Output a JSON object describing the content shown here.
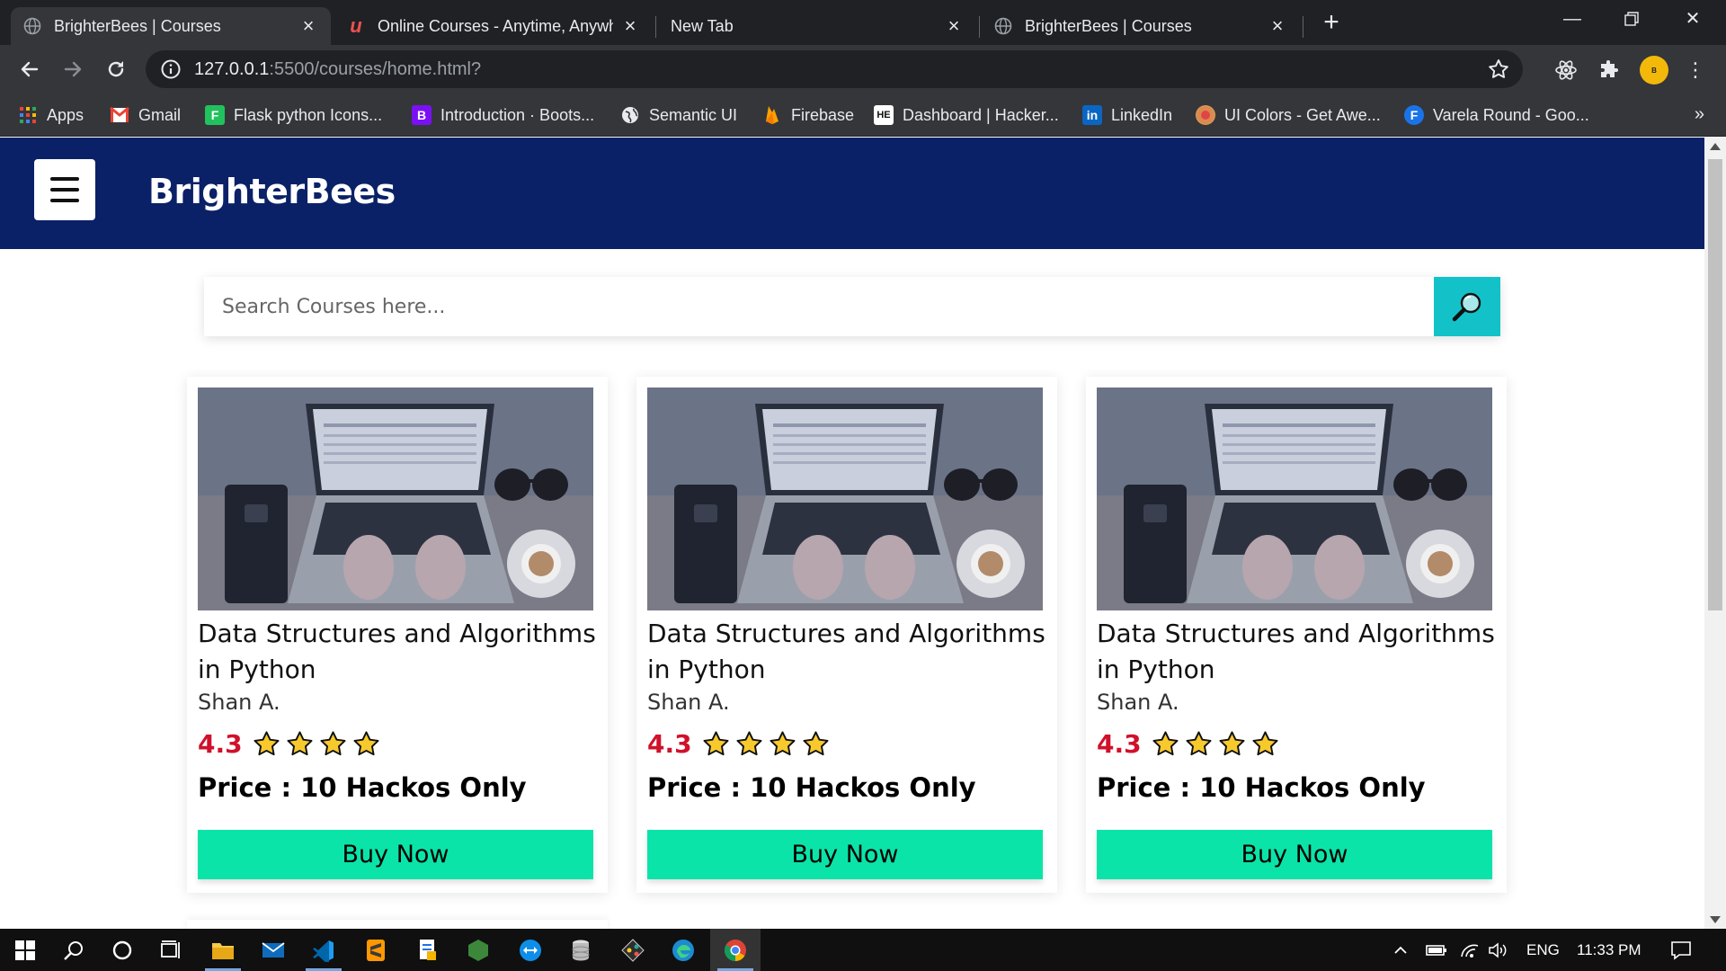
{
  "browser": {
    "tabs": [
      {
        "title": "BrighterBees | Courses",
        "active": true
      },
      {
        "title": "Online Courses - Anytime, Anywh",
        "active": false
      },
      {
        "title": "New Tab",
        "active": false
      },
      {
        "title": "BrighterBees | Courses",
        "active": false
      }
    ],
    "url_host": "127.0.0.1",
    "url_path": ":5500/courses/home.html?",
    "bookmarks": [
      {
        "label": "Apps",
        "icon": "apps-grid-icon"
      },
      {
        "label": "Gmail",
        "icon": "gmail-icon"
      },
      {
        "label": "Flask python Icons...",
        "icon": "flask-icon"
      },
      {
        "label": "Introduction · Boots...",
        "icon": "bootstrap-icon"
      },
      {
        "label": "Semantic UI",
        "icon": "globe-icon"
      },
      {
        "label": "Firebase",
        "icon": "firebase-icon"
      },
      {
        "label": "Dashboard | Hacker...",
        "icon": "hackerearth-icon"
      },
      {
        "label": "LinkedIn",
        "icon": "linkedin-icon"
      },
      {
        "label": "UI Colors - Get Awe...",
        "icon": "uicolors-icon"
      },
      {
        "label": "Varela Round - Goo...",
        "icon": "google-fonts-icon"
      }
    ],
    "bookmarks_more": "»"
  },
  "site": {
    "brand": "BrighterBees",
    "search_placeholder": "Search Courses here...",
    "courses": [
      {
        "title": "Data Structures and Algorithms in Python",
        "author": "Shan A.",
        "rating": "4.3",
        "stars": 4,
        "price": "Price : 10 Hackos Only",
        "button": "Buy Now"
      },
      {
        "title": "Data Structures and Algorithms in Python",
        "author": "Shan A.",
        "rating": "4.3",
        "stars": 4,
        "price": "Price : 10 Hackos Only",
        "button": "Buy Now"
      },
      {
        "title": "Data Structures and Algorithms in Python",
        "author": "Shan A.",
        "rating": "4.3",
        "stars": 4,
        "price": "Price : 10 Hackos Only",
        "button": "Buy Now"
      }
    ]
  },
  "taskbar": {
    "language": "ENG",
    "time": "11:33 PM"
  },
  "colors": {
    "header_bg": "#0a2167",
    "search_button": "#13c2c9",
    "buy_button": "#0be4a8",
    "rating_text": "#d0112b",
    "star_fill": "#f8c92d"
  }
}
